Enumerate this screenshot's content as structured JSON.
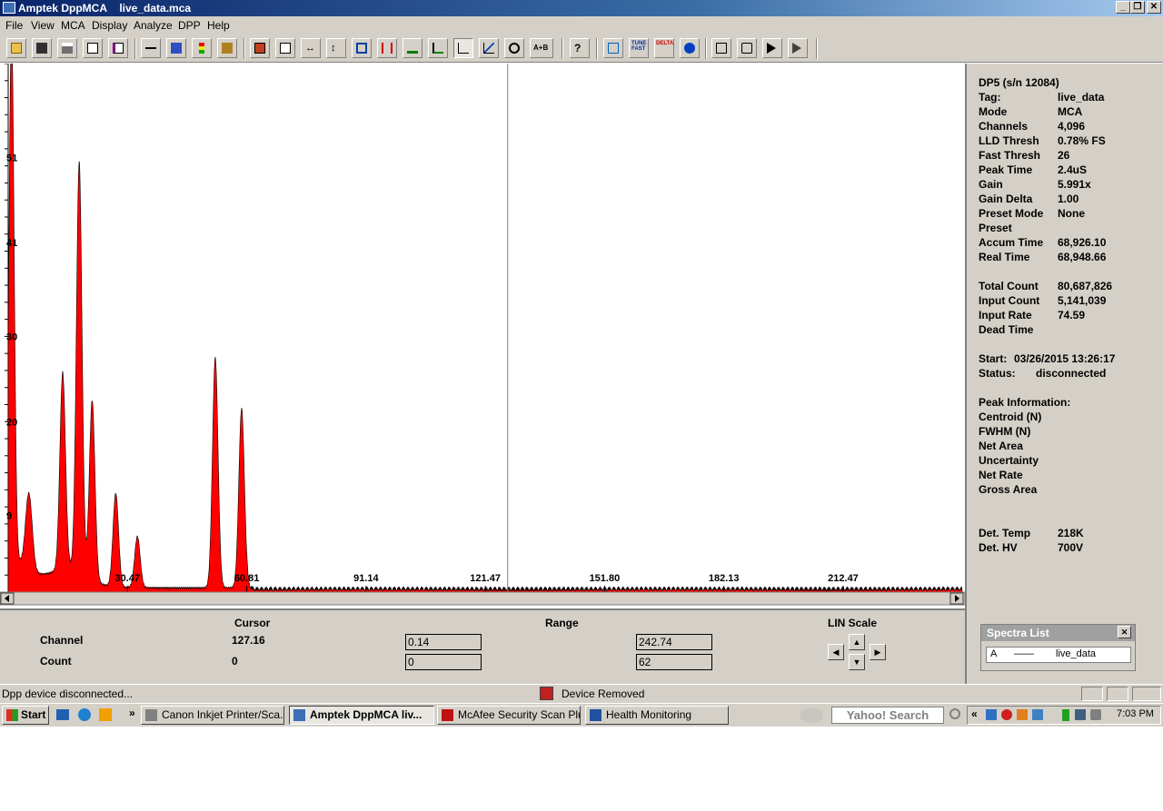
{
  "window": {
    "app_name": "Amptek DppMCA",
    "file_name": "live_data.mca",
    "minimize_label": "_",
    "restore_label": "❐",
    "close_label": "✕"
  },
  "menu": {
    "file": "File",
    "view": "View",
    "mca": "MCA",
    "display": "Display",
    "analyze": "Analyze",
    "dpp": "DPP",
    "help": "Help"
  },
  "toolbar": {
    "icons": [
      "open-folder-icon",
      "save-icon",
      "print-icon",
      "copy-icon",
      "report-icon",
      "connect-icon",
      "acquire-icon",
      "traffic-light-icon",
      "sparkle-icon",
      "data-panel-icon",
      "document-icon",
      "horizontal-expand-icon",
      "vertical-expand-icon",
      "zoom-region-icon",
      "roi-icon",
      "peak-icon",
      "auto-scale-icon",
      "linear-icon",
      "log-icon",
      "search-peak-icon",
      "a-plus-b-icon",
      "help-cursor-icon",
      "calibration-icon",
      "tune-fast-icon",
      "delta-icon",
      "info-icon",
      "home-icon",
      "config-icon",
      "play-icon",
      "step-play-icon"
    ],
    "tune_fast_text": "TUNE FAST",
    "delta_text": "DELTA",
    "a_plus_b_text": "A+B"
  },
  "chart_data": {
    "type": "area",
    "title": "",
    "x_tick_labels": [
      "30.47",
      "60.81",
      "91.14",
      "121.47",
      "151.80",
      "182.13",
      "212.47"
    ],
    "y_tick_labels": [
      "51",
      "41",
      "30",
      "20",
      "9"
    ],
    "xlim": [
      0.14,
      242.74
    ],
    "ylim": [
      0,
      62
    ],
    "cursor_x": 127.16,
    "peaks": [
      {
        "x": 1.0,
        "y": 62
      },
      {
        "x": 5.4,
        "y": 9
      },
      {
        "x": 14.0,
        "y": 23
      },
      {
        "x": 18.2,
        "y": 48
      },
      {
        "x": 21.5,
        "y": 21
      },
      {
        "x": 27.5,
        "y": 11
      },
      {
        "x": 33.0,
        "y": 6
      },
      {
        "x": 52.8,
        "y": 27
      },
      {
        "x": 59.5,
        "y": 21
      },
      {
        "x": 61.0,
        "y": 0.3
      }
    ],
    "series_color": "#ff0000"
  },
  "info_panel": {
    "device": "DP5 (s/n   12084)",
    "rows": [
      {
        "label": "Tag:",
        "value": "live_data"
      },
      {
        "label": "Mode",
        "value": "MCA"
      },
      {
        "label": "Channels",
        "value": "4,096"
      },
      {
        "label": "LLD Thresh",
        "value": "0.78% FS"
      },
      {
        "label": "Fast Thresh",
        "value": "26"
      },
      {
        "label": "Peak Time",
        "value": "2.4uS"
      },
      {
        "label": "Gain",
        "value": "5.991x"
      },
      {
        "label": "Gain Delta",
        "value": "1.00"
      },
      {
        "label": "Preset Mode",
        "value": "None"
      },
      {
        "label": "Preset",
        "value": ""
      },
      {
        "label": "Accum Time",
        "value": "68,926.10"
      },
      {
        "label": "Real Time",
        "value": "68,948.66"
      },
      {
        "label": "Total Count",
        "value": "80,687,826"
      },
      {
        "label": "Input Count",
        "value": "5,141,039"
      },
      {
        "label": "Input Rate",
        "value": "74.59"
      },
      {
        "label": "Dead Time",
        "value": ""
      }
    ],
    "start_label": "Start:",
    "start_value": "03/26/2015 13:26:17",
    "status_label": "Status:",
    "status_value": "disconnected",
    "peak_info_title": "Peak Information:",
    "peak_rows": [
      "Centroid (N)",
      "FWHM (N)",
      "Net Area",
      "Uncertainty",
      "Net Rate",
      "Gross Area"
    ],
    "det_temp_label": "Det. Temp",
    "det_temp_value": "218K",
    "det_hv_label": "Det. HV",
    "det_hv_value": "700V"
  },
  "spectra_list": {
    "title": "Spectra List",
    "close": "✕",
    "item_letter": "A",
    "item_line": "——",
    "item_name": "live_data"
  },
  "bottom_panel": {
    "cursor_header": "Cursor",
    "range_header": "Range",
    "scale_header": "LIN Scale",
    "channel_label": "Channel",
    "count_label": "Count",
    "cursor_channel": "127.16",
    "cursor_count": "0",
    "range_channel_min": "0.14",
    "range_channel_max": "242.74",
    "range_count_min": "0",
    "range_count_max": "62"
  },
  "status_bar": {
    "left": "Dpp device disconnected...",
    "right": "Device Removed"
  },
  "taskbar": {
    "start": "Start",
    "chevron": "»",
    "tasks": [
      {
        "label": "Canon Inkjet Printer/Sca...",
        "icon": "printer-icon"
      },
      {
        "label": "Amptek DppMCA    liv...",
        "icon": "dppmca-icon"
      },
      {
        "label": "McAfee Security Scan Plus",
        "icon": "mcafee-icon"
      },
      {
        "label": "Health Monitoring",
        "icon": "health-icon"
      }
    ],
    "search_placeholder": "Yahoo! Search",
    "tray_chevron": "«",
    "time": "7:03 PM"
  }
}
